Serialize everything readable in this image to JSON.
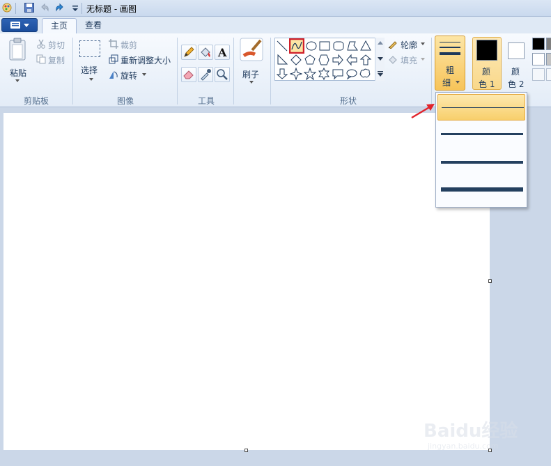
{
  "titlebar": {
    "title": "无标题 - 画图"
  },
  "tabs": [
    {
      "label": "主页",
      "active": true
    },
    {
      "label": "查看",
      "active": false
    }
  ],
  "clipboard": {
    "paste": "粘贴",
    "cut": "剪切",
    "copy": "复制",
    "label": "剪贴板"
  },
  "image": {
    "select": "选择",
    "crop": "裁剪",
    "resize": "重新调整大小",
    "rotate": "旋转",
    "label": "图像"
  },
  "tools": {
    "label": "工具"
  },
  "brush": {
    "label": "刷子"
  },
  "shapes": {
    "outline": "轮廓",
    "fill": "填充",
    "label": "形状"
  },
  "size": {
    "label_line1": "粗",
    "label_line2": "细"
  },
  "color1": {
    "line1": "颜",
    "line2": "色 1",
    "value": "#000000"
  },
  "color2": {
    "line1": "颜",
    "line2": "色 2",
    "value": "#ffffff"
  },
  "size_options": [
    "1px",
    "3px",
    "5px",
    "8px"
  ],
  "size_selected_index": 0,
  "colors": {
    "accent_highlight": "#f8cf6b",
    "line": "#24405f",
    "selected_tool_border": "#d0202a"
  },
  "watermark": {
    "main": "Baidu经验",
    "sub": "jingyan.baidu.com"
  }
}
